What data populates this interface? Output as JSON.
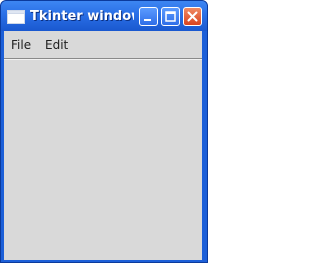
{
  "window": {
    "title": "Tkinter window"
  },
  "titlebar": {
    "icons": [
      "app-window-icon",
      "minimize-icon",
      "maximize-icon",
      "close-icon"
    ],
    "accent": "#2a6fe6",
    "close_color": "#d9431f"
  },
  "menubar": {
    "items": [
      {
        "label": "File"
      },
      {
        "label": "Edit"
      }
    ]
  },
  "colors": {
    "client_background": "#d9d9d9"
  }
}
